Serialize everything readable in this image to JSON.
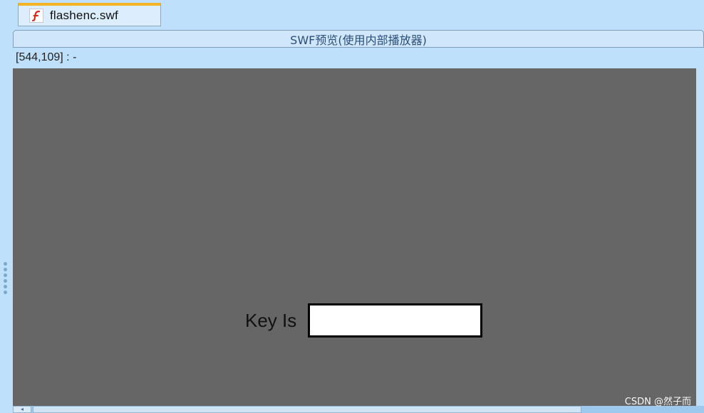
{
  "tab": {
    "filename": "flashenc.swf",
    "icon": "flash-file-icon",
    "accent_color": "#f2b325"
  },
  "panel": {
    "title": "SWF预览(使用内部播放器)"
  },
  "coord_readout": "[544,109] : -",
  "swf": {
    "key_label": "Key Is",
    "key_value": ""
  },
  "watermark": "CSDN @然子而",
  "colors": {
    "stage_bg": "#666666",
    "app_bg": "#bfe0fa",
    "title_color": "#2c4f78"
  }
}
